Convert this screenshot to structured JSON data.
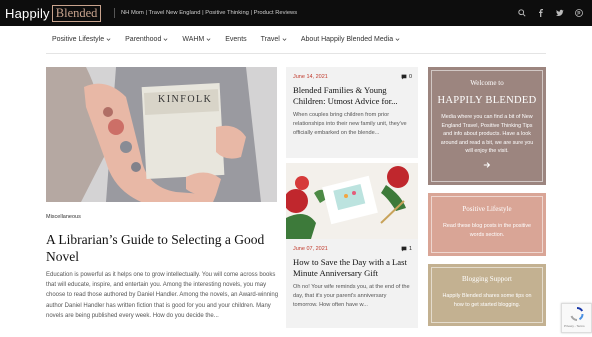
{
  "header": {
    "logo_part1": "Happily",
    "logo_part2": "Blended",
    "tagline": "NH Mom | Travel New England | Positive Thinking | Product Reviews",
    "icons": [
      "search-icon",
      "facebook-icon",
      "twitter-icon",
      "pinterest-icon"
    ]
  },
  "nav": {
    "items": [
      {
        "label": "Positive Lifestyle",
        "dropdown": true
      },
      {
        "label": "Parenthood",
        "dropdown": true
      },
      {
        "label": "WAHM",
        "dropdown": true
      },
      {
        "label": "Events",
        "dropdown": false
      },
      {
        "label": "Travel",
        "dropdown": true
      },
      {
        "label": "About Happily Blended Media",
        "dropdown": true
      }
    ]
  },
  "hero": {
    "image_text": "KINFOLK",
    "category": "Miscellaneous",
    "title": "A Librarian’s Guide to Selecting a Good Novel",
    "excerpt": "Education is powerful as it helps one to grow intellectually. You will come across books that will educate, inspire, and entertain you. Among the interesting novels, you may choose to read those authored by Daniel Handler. Among the novels, an Award-winning author Daniel Handler has written fiction that is good for you and your children. Many novels are being published every week. How do you decide the..."
  },
  "cards": [
    {
      "date": "June 14, 2021",
      "comments": "0",
      "title": "Blended Families & Young Children: Utmost Advice for...",
      "excerpt": "When couples bring children from prior relationships into their new family unit, they've officially embarked on the blende..."
    },
    {
      "date": "June 07, 2021",
      "comments": "1",
      "title": "How to Save the Day with a Last Minute Anniversary Gift",
      "excerpt": "Oh no! Your wife reminds you, at the end of the day, that it's your parent's anniversary tomorrow. How often have w..."
    }
  ],
  "sidebar": {
    "welcome": {
      "title": "Welcome to",
      "big": "HAPPILY BLENDED",
      "text": "Media where you can find a bit of New England Travel, Positive Thinking Tips and info about products. Have a look around and read a bit, we are sure you will enjoy the visit."
    },
    "positive": {
      "title": "Positive Lifestyle",
      "text": "Read these blog posts in the positive words section."
    },
    "blogging": {
      "title": "Blogging Support",
      "text": "Happily Blended shares some tips on how to get started blogging."
    }
  },
  "recaptcha": {
    "text": "Privacy - Terms"
  },
  "colors": {
    "topbar": "#0d0d0d",
    "accent_date": "#c0392b",
    "widget_welcome": "#9c857f",
    "widget_positive": "#d9a596",
    "widget_blogging": "#c3b191"
  }
}
